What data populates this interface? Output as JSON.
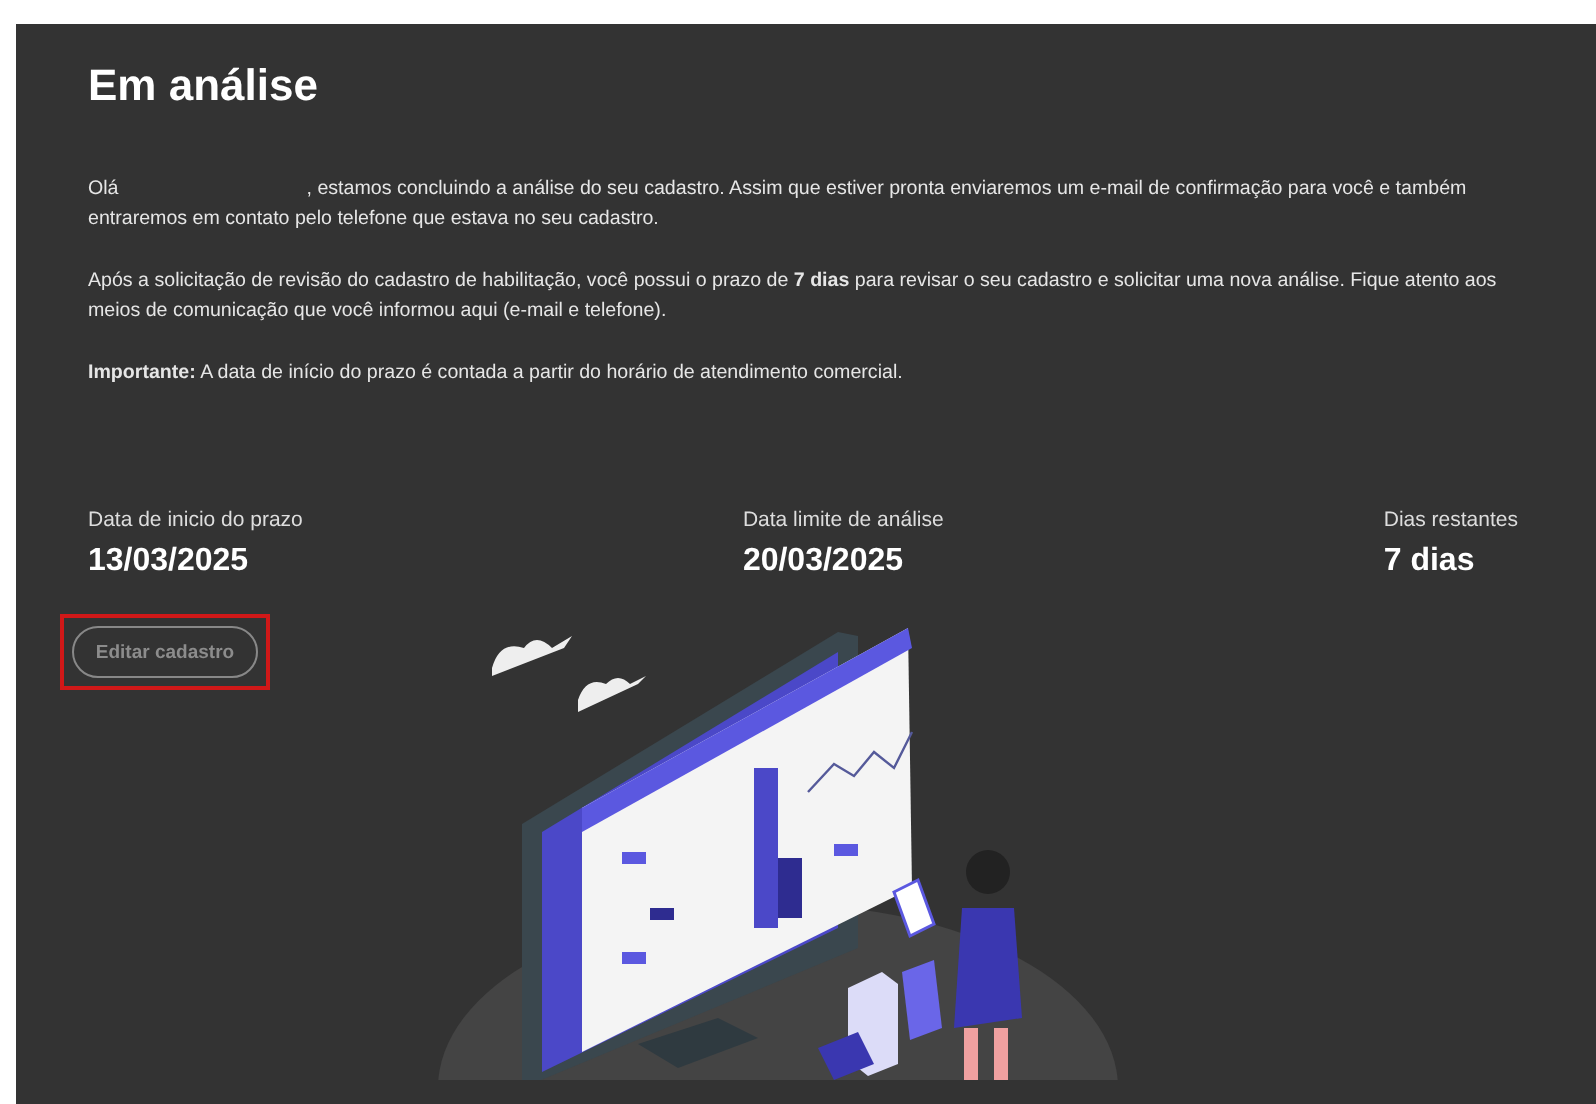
{
  "title": "Em análise",
  "paragraphs": [
    {
      "greeting": "Olá",
      "text": ", estamos concluindo a análise do seu cadastro. Assim que estiver pronta enviaremos um e-mail de confirmação para você e também entraremos em contato pelo telefone que estava no seu cadastro."
    },
    {
      "text": "Após a solicitação de revisão do cadastro de habilitação, você possui o prazo de **7 dias** para revisar o seu cadastro e solicitar uma nova análise. Fique atento aos meios de comunicação que você informou aqui (e-mail e telefone)."
    },
    {
      "text": "**Importante:** A data de início do prazo é contada a partir do horário de atendimento comercial."
    }
  ],
  "stats": [
    {
      "label": "Data de inicio do prazo",
      "value": "13/03/2025"
    },
    {
      "label": "Data limite de análise",
      "value": "20/03/2025"
    },
    {
      "label": "Dias restantes",
      "value": "7 dias"
    }
  ],
  "edit_button": {
    "label": "Editar cadastro",
    "disabled": true,
    "highlighted": true
  }
}
